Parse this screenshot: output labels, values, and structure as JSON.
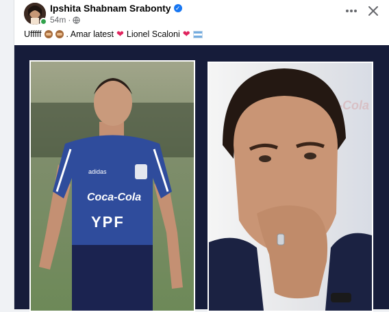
{
  "post": {
    "author_name": "Ipshita Shabnam Srabonty",
    "time": "54m",
    "caption_lead": "Ufffff",
    "caption_mid": ". Amar latest",
    "caption_name": "Lionel Scaloni"
  },
  "icons": {
    "verified": "verified-badge-icon",
    "audience": "globe-icon",
    "more": "more-options-icon",
    "close": "close-icon"
  },
  "photos": {
    "left_brand": "Coca-Cola",
    "left_sponsor": "YPF",
    "left_kit": "adidas",
    "right_bg_brand": "Coca-Cola"
  },
  "colors": {
    "accent": "#1877f2",
    "online": "#31a24c",
    "media_bg": "#161c3a",
    "jersey": "#2f4c9c"
  }
}
